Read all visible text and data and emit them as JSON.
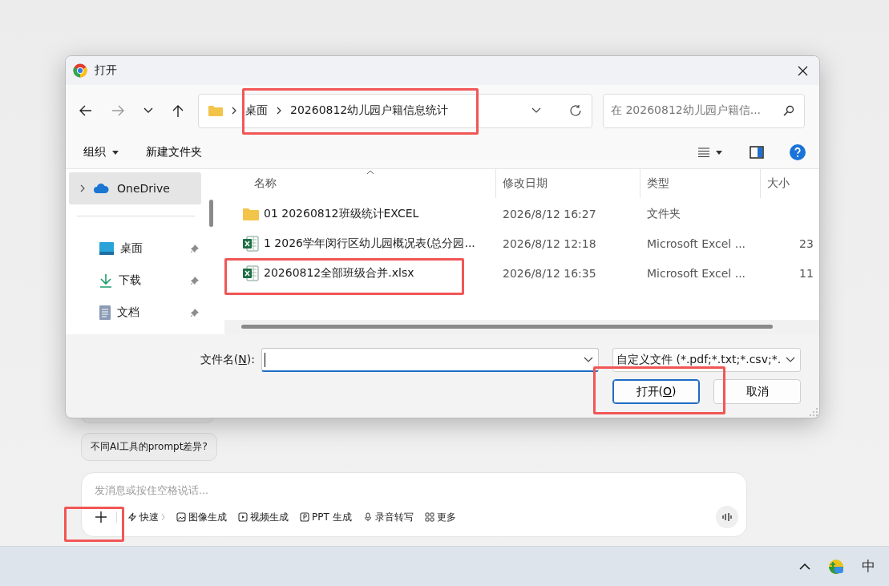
{
  "window": {
    "title": "打开"
  },
  "address": {
    "crumbs": [
      "桌面",
      "20260812幼儿园户籍信息统计"
    ],
    "search_placeholder": "在 20260812幼儿园户籍信..."
  },
  "toolbar": {
    "organize": "组织",
    "new_folder": "新建文件夹"
  },
  "sidebar": {
    "items": [
      {
        "label": "OneDrive",
        "kind": "cloud",
        "selected": true,
        "pinned": false
      },
      {
        "label": "桌面",
        "kind": "desktop",
        "selected": false,
        "pinned": true
      },
      {
        "label": "下载",
        "kind": "download",
        "selected": false,
        "pinned": true
      },
      {
        "label": "文档",
        "kind": "document",
        "selected": false,
        "pinned": true
      }
    ]
  },
  "table": {
    "columns": [
      "名称",
      "修改日期",
      "类型",
      "大小"
    ],
    "rows": [
      {
        "kind": "folder",
        "name": "01 20260812班级统计EXCEL",
        "modified": "2026/8/12 16:27",
        "type": "文件夹"
      },
      {
        "kind": "excel",
        "name": "1 2026学年闵行区幼儿园概况表(总分园...",
        "modified": "2026/8/12 12:18",
        "type": "Microsoft Excel ...",
        "size": "23"
      },
      {
        "kind": "excel",
        "name": "20260812全部班级合并.xlsx",
        "modified": "2026/8/12 16:35",
        "type": "Microsoft Excel ...",
        "size": "11"
      }
    ]
  },
  "file_name": {
    "label": {
      "before": "文件名(",
      "key": "N",
      "after": "):"
    }
  },
  "file_type": "自定义文件 (*.pdf;*.txt;*.csv;*.",
  "buttons": [
    {
      "before": "打开(",
      "key": "O",
      "after": ")",
      "default": true
    },
    {
      "before": "取消",
      "default": false
    }
  ],
  "chat": {
    "suggestion": "不同AI工具的prompt差异?",
    "placeholder": "发消息或按住空格说话...",
    "tools": [
      {
        "kind": "bolt",
        "label": "快速"
      },
      {
        "kind": "image",
        "label": "图像生成"
      },
      {
        "kind": "video",
        "label": "视频生成"
      },
      {
        "kind": "ppt",
        "label": "PPT 生成"
      },
      {
        "kind": "mic",
        "label": "录音转写"
      },
      {
        "kind": "grid",
        "label": "更多"
      }
    ]
  },
  "taskbar": {
    "ime": "中"
  }
}
